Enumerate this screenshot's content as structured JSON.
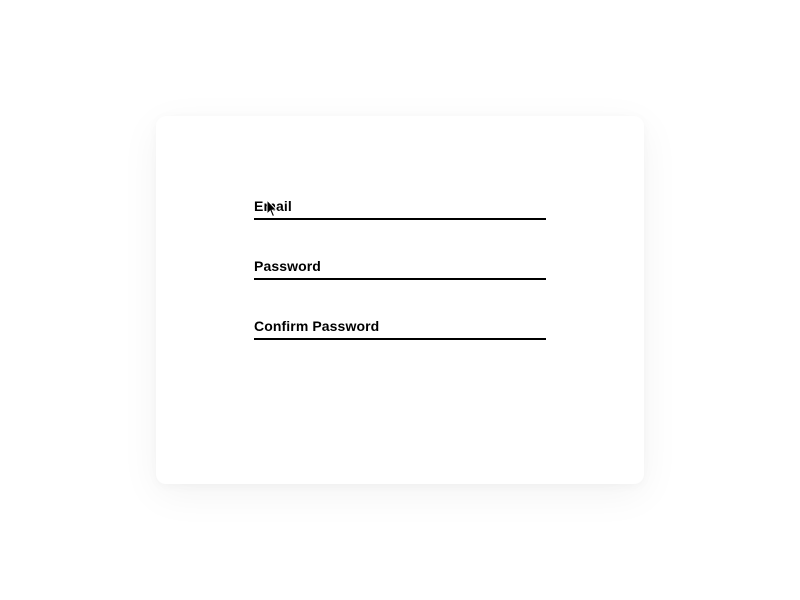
{
  "form": {
    "fields": [
      {
        "label": "Email",
        "value": "",
        "type": "email"
      },
      {
        "label": "Password",
        "value": "",
        "type": "password"
      },
      {
        "label": "Confirm Password",
        "value": "",
        "type": "password"
      }
    ]
  }
}
